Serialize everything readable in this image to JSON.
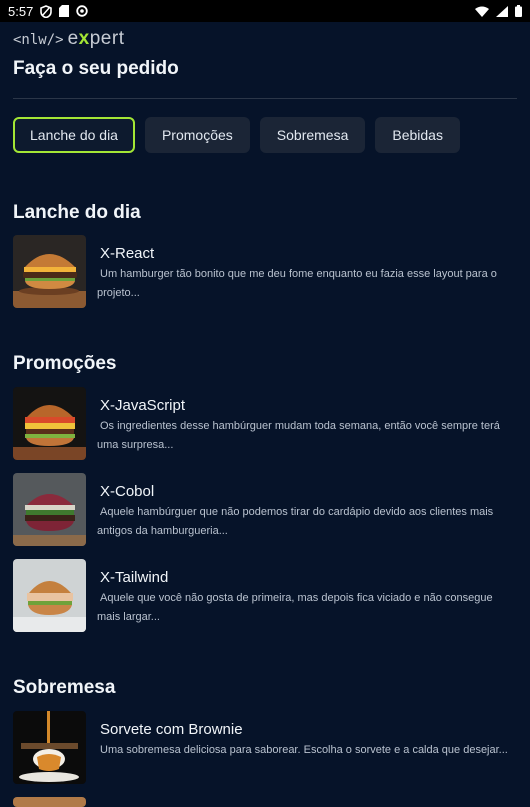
{
  "status_bar": {
    "time": "5:57",
    "left_icons": [
      "shield-icon",
      "sd-card-icon",
      "sync-icon"
    ],
    "right_icons": [
      "wifi-icon",
      "signal-icon",
      "battery-icon"
    ]
  },
  "header": {
    "logo_left": "<nlw/>",
    "logo_right_pre": "e",
    "logo_right_x": "x",
    "logo_right_post": "pert",
    "title": "Faça o seu pedido"
  },
  "tabs": [
    {
      "label": "Lanche do dia",
      "active": true
    },
    {
      "label": "Promoções",
      "active": false
    },
    {
      "label": "Sobremesa",
      "active": false
    },
    {
      "label": "Bebidas",
      "active": false
    }
  ],
  "sections": [
    {
      "title": "Lanche do dia",
      "items": [
        {
          "name": "X-React",
          "description": "Um hamburger tão bonito que me deu fome enquanto eu fazia esse layout para o projeto..."
        }
      ]
    },
    {
      "title": "Promoções",
      "items": [
        {
          "name": "X-JavaScript",
          "description": "Os ingredientes desse hambúrguer mudam toda semana, então você sempre terá uma surpresa..."
        },
        {
          "name": "X-Cobol",
          "description": "Aquele hambúrguer que não podemos tirar do cardápio devido aos clientes mais antigos da hamburgueria..."
        },
        {
          "name": "X-Tailwind",
          "description": "Aquele que você não gosta de primeira, mas depois fica viciado e não consegue mais largar..."
        }
      ]
    },
    {
      "title": "Sobremesa",
      "items": [
        {
          "name": "Sorvete com Brownie",
          "description": "Uma sobremesa deliciosa para saborear. Escolha o sorvete e a calda que desejar..."
        }
      ]
    }
  ],
  "colors": {
    "background": "#061329",
    "accent": "#a3e635",
    "tab_background": "#1b2536"
  }
}
